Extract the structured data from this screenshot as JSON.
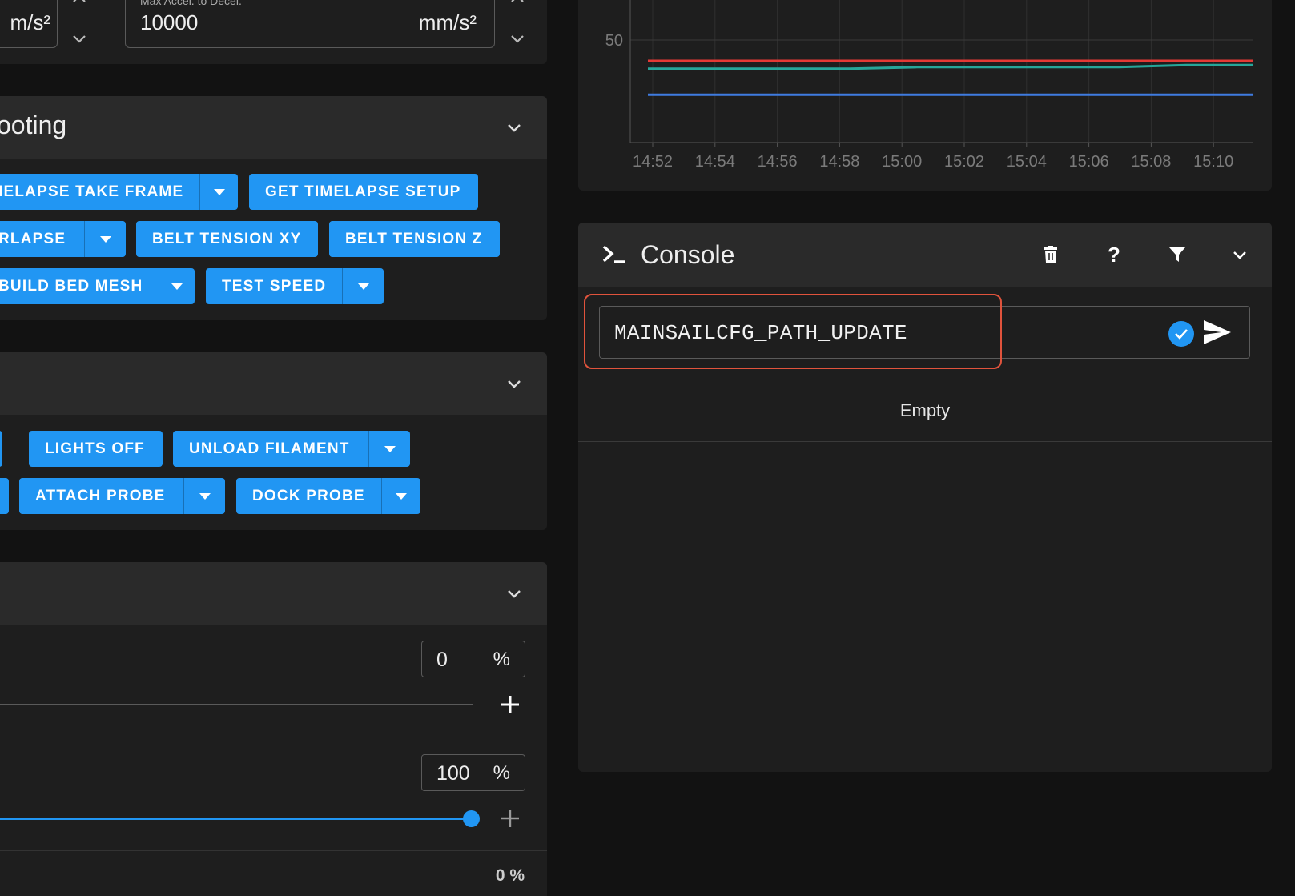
{
  "accel_panel": {
    "left_unit": "m/s²",
    "field_label": "Max Accel. to Decel.",
    "field_value": "10000",
    "field_unit": "mm/s²"
  },
  "macros_panel_1": {
    "title": "ooting",
    "buttons": [
      {
        "label": "IELAPSE TAKE FRAME"
      },
      {
        "label": "GET TIMELAPSE SETUP"
      },
      {
        "label": "RLAPSE"
      },
      {
        "label": "BELT TENSION XY"
      },
      {
        "label": "BELT TENSION Z"
      },
      {
        "label": "BUILD BED MESH"
      },
      {
        "label": "TEST SPEED"
      }
    ]
  },
  "macros_panel_2": {
    "buttons": [
      {
        "label": "LIGHTS OFF"
      },
      {
        "label": "UNLOAD FILAMENT"
      },
      {
        "label": "ATTACH PROBE"
      },
      {
        "label": "DOCK PROBE"
      }
    ]
  },
  "sliders_panel": {
    "slider1": {
      "value": "0",
      "unit": "%",
      "fraction": 0
    },
    "slider2": {
      "value": "100",
      "unit": "%",
      "fraction": 1
    },
    "footer_value": "0 %"
  },
  "chart_data": {
    "type": "line",
    "x": [
      "14:52",
      "14:54",
      "14:56",
      "14:58",
      "15:00",
      "15:02",
      "15:04",
      "15:06",
      "15:08",
      "15:10"
    ],
    "y_ticks": [
      "50"
    ],
    "series": [
      {
        "color": "#e53935",
        "values": [
          46,
          46,
          46,
          46,
          46,
          46,
          46,
          46,
          46,
          46
        ]
      },
      {
        "color": "#26a69a",
        "values": [
          44.5,
          44.5,
          44.5,
          44.5,
          44.8,
          44.8,
          44.8,
          44.8,
          45.2,
          45.2
        ]
      },
      {
        "color": "#3f7be0",
        "values": [
          39.5,
          39.5,
          39.5,
          39.5,
          39.5,
          39.5,
          39.5,
          39.5,
          39.5,
          39.5
        ]
      }
    ],
    "grid": true
  },
  "console": {
    "title": "Console",
    "input_value": "MAINSAILCFG_PATH_UPDATE",
    "empty_text": "Empty",
    "icons": [
      "delete-icon",
      "help-icon",
      "filter-icon",
      "chevron-down-icon"
    ]
  },
  "colors": {
    "accent": "#2196f3",
    "highlight": "#e0533c"
  }
}
